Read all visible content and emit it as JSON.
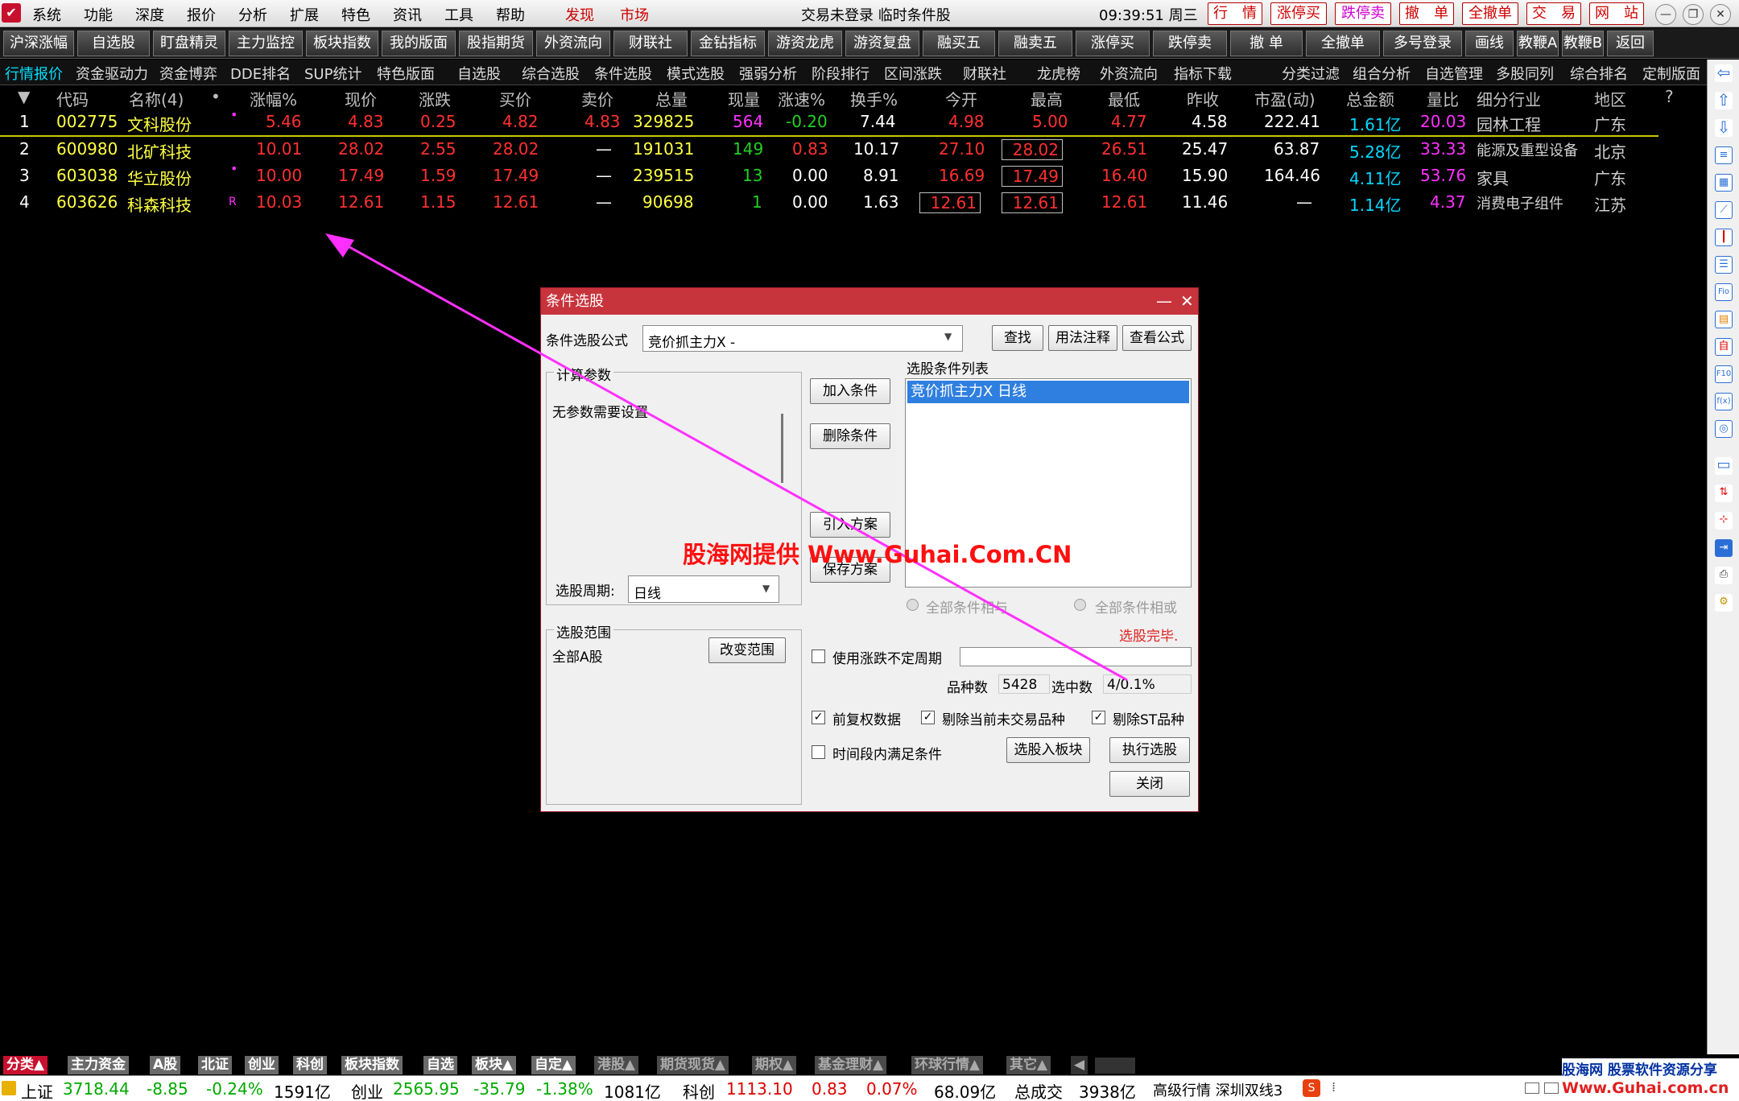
{
  "menu": [
    "系统",
    "功能",
    "深度",
    "报价",
    "分析",
    "扩展",
    "特色",
    "资讯",
    "工具",
    "帮助"
  ],
  "menu_red": [
    "发现",
    "市场"
  ],
  "title": "交易未登录  临时条件股",
  "clock": "09:39:51 周三",
  "right_buttons": [
    "行　情",
    "涨停买",
    "跌停卖",
    "撤　单",
    "全撤单",
    "交　易",
    "网　站"
  ],
  "window_controls": [
    "—",
    "❐",
    "✕"
  ],
  "toolbar": [
    "沪深涨幅",
    "自选股",
    "盯盘精灵",
    "主力监控",
    "板块指数",
    "我的版面",
    "股指期货",
    "外资流向",
    "财联社",
    "金钻指标",
    "游资龙虎",
    "游资复盘",
    "融买五",
    "融卖五",
    "涨停买",
    "跌停卖",
    "撤 单",
    "全撤单",
    "多号登录",
    "画线",
    "教鞭A",
    "教鞭B",
    "返回"
  ],
  "tabs": [
    "行情报价",
    "资金驱动力",
    "资金博弈",
    "DDE排名",
    "SUP统计",
    "特色版面",
    "自选股",
    "综合选股",
    "条件选股",
    "模式选股",
    "强弱分析",
    "阶段排行",
    "区间涨跌",
    "财联社",
    "龙虎榜",
    "外资流向",
    "指标下载",
    "分类过滤",
    "组合分析",
    "自选管理",
    "多股同列",
    "综合排名",
    "定制版面"
  ],
  "columns": [
    "▼",
    "代码",
    "名称(4)",
    "•",
    "涨幅%",
    "现价",
    "涨跌",
    "买价",
    "卖价",
    "总量",
    "现量",
    "涨速%",
    "换手%",
    "今开",
    "最高",
    "最低",
    "昨收",
    "市盈(动)",
    "总金额",
    "量比",
    "细分行业",
    "地区",
    "?"
  ],
  "rows": [
    {
      "idx": "1",
      "code": "002775",
      "name": "文科股份",
      "flag": "•",
      "chg": "5.46",
      "price": "4.83",
      "diff": "0.25",
      "bid": "4.82",
      "ask": "4.83",
      "vol": "329825",
      "cur": "564",
      "speed": "-0.20",
      "turn": "7.44",
      "open": "4.98",
      "high": "5.00",
      "low": "4.77",
      "prev": "4.58",
      "pe": "222.41",
      "amt": "1.61亿",
      "vr": "20.03",
      "ind": "园林工程",
      "reg": "广东"
    },
    {
      "idx": "2",
      "code": "600980",
      "name": "北矿科技",
      "flag": "",
      "chg": "10.01",
      "price": "28.02",
      "diff": "2.55",
      "bid": "28.02",
      "ask": "—",
      "vol": "191031",
      "cur": "149",
      "speed": "0.83",
      "turn": "10.17",
      "open": "27.10",
      "high": "28.02",
      "low": "26.51",
      "prev": "25.47",
      "pe": "63.87",
      "amt": "5.28亿",
      "vr": "33.33",
      "ind": "能源及重型设备",
      "reg": "北京"
    },
    {
      "idx": "3",
      "code": "603038",
      "name": "华立股份",
      "flag": "•",
      "chg": "10.00",
      "price": "17.49",
      "diff": "1.59",
      "bid": "17.49",
      "ask": "—",
      "vol": "239515",
      "cur": "13",
      "speed": "0.00",
      "turn": "8.91",
      "open": "16.69",
      "high": "17.49",
      "low": "16.40",
      "prev": "15.90",
      "pe": "164.46",
      "amt": "4.11亿",
      "vr": "53.76",
      "ind": "家具",
      "reg": "广东"
    },
    {
      "idx": "4",
      "code": "603626",
      "name": "科森科技",
      "flag": "R",
      "chg": "10.03",
      "price": "12.61",
      "diff": "1.15",
      "bid": "12.61",
      "ask": "—",
      "vol": "90698",
      "cur": "1",
      "speed": "0.00",
      "turn": "1.63",
      "open": "12.61",
      "high": "12.61",
      "low": "12.61",
      "prev": "11.46",
      "pe": "—",
      "amt": "1.14亿",
      "vr": "4.37",
      "ind": "消费电子组件",
      "reg": "江苏"
    }
  ],
  "dialog": {
    "title": "条件选股",
    "formula_label": "条件选股公式",
    "formula_value": "竞价抓主力X  -",
    "btn_find": "查找",
    "btn_usage": "用法注释",
    "btn_view": "查看公式",
    "params_group": "计算参数",
    "params_text": "无参数需要设置",
    "btn_add": "加入条件",
    "btn_del": "删除条件",
    "btn_import": "引入方案",
    "btn_save": "保存方案",
    "list_label": "选股条件列表",
    "list_items": [
      "竞价抓主力X  日线"
    ],
    "period_label": "选股周期:",
    "period_value": "日线",
    "radio_and": "全部条件相与",
    "radio_or": "全部条件相或",
    "status": "选股完毕.",
    "scope_group": "选股范围",
    "scope_value": "全部A股",
    "btn_scope": "改变范围",
    "cb_period": "使用涨跌不定周期",
    "count_label": "品种数",
    "count_value": "5428",
    "selected_label": "选中数",
    "selected_value": "4/0.1%",
    "cb_fq": "前复权数据",
    "cb_notrade": "剔除当前未交易品种",
    "cb_st": "剔除ST品种",
    "cb_time": "时间段内满足条件",
    "btn_toblock": "选股入板块",
    "btn_run": "执行选股",
    "btn_close": "关闭"
  },
  "watermark": "股海网提供 Www.Guhai.Com.CN",
  "bottom_tabs": [
    "分类▲",
    "主力资金",
    "A股",
    "北证",
    "创业",
    "科创",
    "板块指数",
    "自选",
    "板块▲",
    "自定▲",
    "港股▲",
    "期货现货▲",
    "期权▲",
    "基金理财▲",
    "环球行情▲",
    "其它▲"
  ],
  "status": {
    "sh_label": "上证",
    "sh_val": "3718.44",
    "sh_chg": "-8.85",
    "sh_pct": "-0.24%",
    "sh_amt": "1591亿",
    "cy_label": "创业",
    "cy_val": "2565.95",
    "cy_chg": "-35.79",
    "cy_pct": "-1.38%",
    "cy_amt": "1081亿",
    "kc_label": "科创",
    "kc_val": "1113.10",
    "kc_chg": "0.83",
    "kc_pct": "0.07%",
    "kc_amt": "68.09亿",
    "total_label": "总成交",
    "total_val": "3938亿",
    "server": "高级行情 深圳双线3",
    "logo_top": "股海网 股票软件资源分享",
    "logo_bottom": "Www.Guhai.com.cn"
  },
  "colors": {
    "up": "#ff3030",
    "down": "#22d022",
    "accent": "#c8343c",
    "cyan": "#00d8ff"
  }
}
